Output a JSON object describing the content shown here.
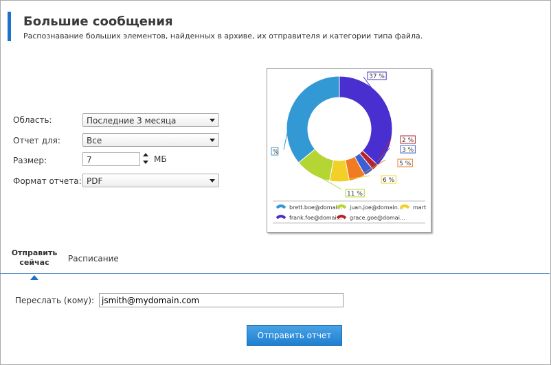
{
  "header": {
    "title": "Большие сообщения",
    "subtitle": "Распознавание больших элементов, найденных в архиве, их отправителя и категории типа файла."
  },
  "form": {
    "scope_label": "Область:",
    "scope_value": "Последние 3 месяца",
    "report_for_label": "Отчет для:",
    "report_for_value": "Все",
    "size_label": "Размер:",
    "size_value": "7",
    "size_unit": "МБ",
    "format_label": "Формат отчета:",
    "format_value": "PDF"
  },
  "tabs": {
    "send_now": "Отправить сейчас",
    "schedule": "Расписание"
  },
  "send": {
    "forward_label": "Переслать (кому):",
    "forward_value": "jsmith@mydomain.com",
    "button_label": "Отправить отчет"
  },
  "chart_data": {
    "type": "pie",
    "donut": true,
    "slices": [
      {
        "name": "frank.foe@domai...",
        "value": 37,
        "label": "37 %",
        "color": "#4a2fd0"
      },
      {
        "name": "grace.goe@domai...",
        "value": 2,
        "label": "2 %",
        "color": "#b8242b"
      },
      {
        "name": "",
        "value": 3,
        "label": "3 %",
        "color": "#3d5fd4"
      },
      {
        "name": "",
        "value": 5,
        "label": "5 %",
        "color": "#f07b22"
      },
      {
        "name": "mart",
        "value": 6,
        "label": "6 %",
        "color": "#f2d028"
      },
      {
        "name": "juan.joe@domain...",
        "value": 11,
        "label": "11 %",
        "color": "#b4d534"
      },
      {
        "name": "brett.boe@domai...",
        "value": 36,
        "label": "%",
        "color": "#3399d4"
      }
    ],
    "legend": [
      {
        "label": "brett.boe@domai...",
        "color": "#3399d4"
      },
      {
        "label": "juan.joe@domain...",
        "color": "#b4d534"
      },
      {
        "label": "mart",
        "color": "#f2d028"
      },
      {
        "label": "frank.foe@domai...",
        "color": "#4a2fd0"
      },
      {
        "label": "grace.goe@domai...",
        "color": "#b8242b"
      }
    ],
    "legend_position": "bottom"
  }
}
